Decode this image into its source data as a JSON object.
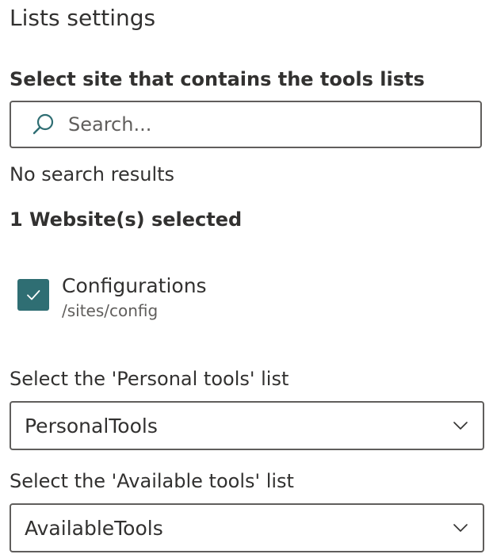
{
  "panel": {
    "title": "Lists settings"
  },
  "site_selector": {
    "label": "Select site that contains the tools lists",
    "search_placeholder": "Search...",
    "search_value": "",
    "no_results_text": "No search results",
    "selected_count_text": "1 Website(s) selected",
    "selected_sites": [
      {
        "name": "Configurations",
        "url": "/sites/config",
        "checked": true
      }
    ]
  },
  "personal_tools": {
    "label": "Select the 'Personal tools' list",
    "value": "PersonalTools"
  },
  "available_tools": {
    "label": "Select the 'Available tools' list",
    "value": "AvailableTools"
  },
  "colors": {
    "accent": "#2f6e73",
    "text": "#323130",
    "secondary_text": "#605e5c",
    "border": "#605e5c"
  }
}
